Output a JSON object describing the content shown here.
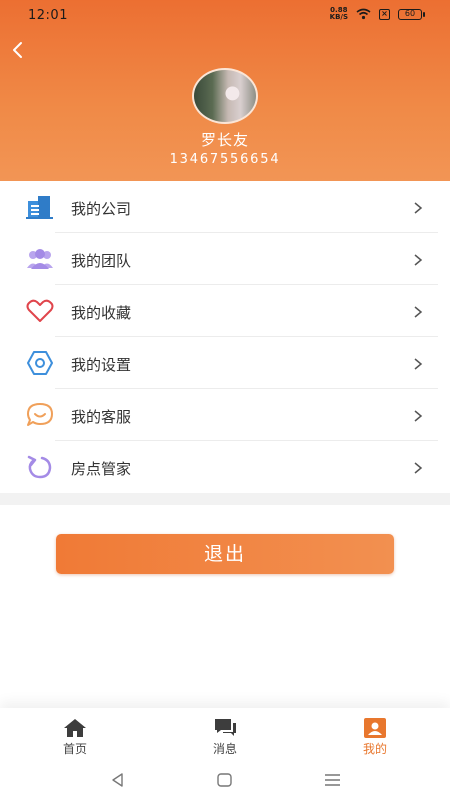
{
  "status_bar": {
    "time": "12:01",
    "net_speed": "0.88",
    "net_unit": "KB/S",
    "battery": "60"
  },
  "profile": {
    "name": "罗长友",
    "phone": "13467556654"
  },
  "menu": [
    {
      "label": "我的公司",
      "icon": "building-icon",
      "color": "#3d8fdc"
    },
    {
      "label": "我的团队",
      "icon": "team-icon",
      "color": "#a48be6"
    },
    {
      "label": "我的收藏",
      "icon": "heart-icon",
      "color": "#e0454c"
    },
    {
      "label": "我的设置",
      "icon": "gear-icon",
      "color": "#3d8fdc"
    },
    {
      "label": "我的客服",
      "icon": "chat-bubble-icon",
      "color": "#f0a05a"
    },
    {
      "label": "房点管家",
      "icon": "refresh-icon",
      "color": "#a48be6"
    }
  ],
  "logout_label": "退出",
  "tabs": [
    {
      "label": "首页",
      "icon": "home-icon",
      "active": false
    },
    {
      "label": "消息",
      "icon": "message-icon",
      "active": false
    },
    {
      "label": "我的",
      "icon": "profile-icon",
      "active": true
    }
  ],
  "colors": {
    "accent": "#ee7a38",
    "header_top": "#ec6f32",
    "header_bottom": "#f29555"
  }
}
